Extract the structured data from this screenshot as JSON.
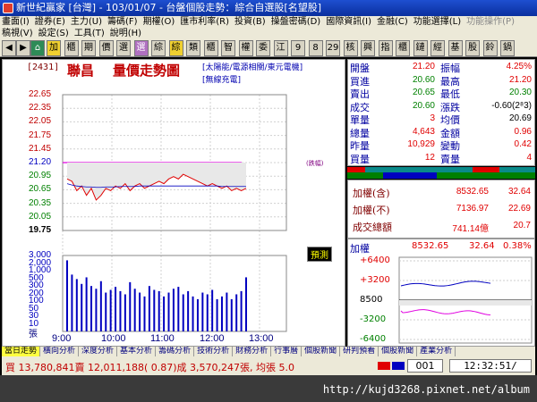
{
  "window": {
    "title": "新世紀贏家 [台灣] - 103/01/07 - 台盤個股走勢：綜合自選股[名望股]"
  },
  "menu": {
    "row1": [
      "畫面(I)",
      "證券(E)",
      "主力(U)",
      "籌碼(F)",
      "期權(O)",
      "匯市利率(R)",
      "投資(B)",
      "操盤密碼(D)",
      "國際資訊(I)",
      "金融(C)",
      "功能選擇(L)"
    ],
    "row1_dim": "功能操作(P)",
    "row2": [
      "稿視(V)",
      "設定(S)",
      "工具(T)",
      "說明(H)"
    ]
  },
  "toolbar": {
    "buttons": [
      "加",
      "櫃",
      "期",
      "價",
      "選",
      "選",
      "綜",
      "綜",
      "類",
      "櫃",
      "智",
      "權",
      "委",
      "江",
      "9",
      "8",
      "29",
      "核",
      "興",
      "指",
      "櫃",
      "鏈",
      "經",
      "基",
      "股",
      "鈴",
      "鍋"
    ]
  },
  "header": {
    "code": "[2431]",
    "name": "聯昌",
    "title": "量價走勢圖",
    "tag1": "[太陽能/電源相關/東元電機]",
    "tag2": "[無線充電]"
  },
  "chart_data": {
    "type": "line",
    "price_axis": {
      "ticks": [
        "22.65",
        "22.35",
        "22.05",
        "21.75",
        "21.45",
        "21.20",
        "20.95",
        "20.65",
        "20.35",
        "20.05",
        "19.75"
      ],
      "limit_label": "(跌幅)"
    },
    "volume_axis": {
      "ticks": [
        "3,000",
        "2,000",
        "1,000",
        "500",
        "300",
        "200",
        "100",
        "50",
        "30",
        "10",
        "張"
      ]
    },
    "x": {
      "ticks": [
        "9:00",
        "10:00",
        "11:00",
        "12:00",
        "13:00"
      ]
    },
    "reference_price": 21.2,
    "ylim": [
      19.75,
      22.65
    ],
    "price_series": [
      20.85,
      20.8,
      20.6,
      20.7,
      20.5,
      20.65,
      20.4,
      20.5,
      20.65,
      20.6,
      20.7,
      20.65,
      20.75,
      20.6,
      20.7,
      20.75,
      20.65,
      20.7,
      20.75,
      20.8,
      20.75,
      20.85,
      20.9,
      20.85,
      20.95,
      20.9,
      20.85,
      20.8,
      20.75,
      20.7,
      20.75,
      20.7,
      20.65,
      20.7,
      20.6,
      20.65,
      20.6,
      20.65
    ],
    "avg_series": [
      20.75,
      20.72,
      20.7,
      20.69,
      20.68,
      20.68,
      20.67,
      20.67,
      20.68,
      20.68,
      20.68,
      20.69,
      20.69,
      20.69,
      20.69,
      20.7,
      20.7,
      20.7,
      20.7,
      20.7,
      20.7,
      20.7,
      20.7,
      20.7,
      20.7,
      20.7,
      20.7,
      20.7,
      20.7,
      20.7,
      20.7,
      20.7,
      20.69,
      20.69,
      20.69,
      20.69,
      20.69,
      20.69
    ],
    "volume_series": [
      1800,
      400,
      250,
      150,
      300,
      120,
      90,
      200,
      60,
      80,
      110,
      70,
      50,
      180,
      90,
      60,
      40,
      120,
      80,
      70,
      40,
      60,
      90,
      110,
      50,
      70,
      40,
      30,
      60,
      50,
      80,
      30,
      40,
      60,
      30,
      50,
      70,
      300
    ],
    "predict_label": "預測"
  },
  "quote": {
    "rows": [
      {
        "l1": "開盤",
        "v1": "21.20",
        "c1": "red",
        "l2": "振幅",
        "v2": "4.25%",
        "c2": "red"
      },
      {
        "l1": "買進",
        "v1": "20.60",
        "c1": "grn",
        "l2": "最高",
        "v2": "21.20",
        "c2": "red"
      },
      {
        "l1": "賣出",
        "v1": "20.65",
        "c1": "grn",
        "l2": "最低",
        "v2": "20.30",
        "c2": "grn"
      },
      {
        "l1": "成交",
        "v1": "20.60",
        "c1": "grn",
        "l2": "漲跌",
        "v2": "-0.60(2⁸3)",
        "c2": "blk"
      },
      {
        "l1": "單量",
        "v1": "3",
        "c1": "red",
        "l2": "均價",
        "v2": "20.69",
        "c2": "blk"
      },
      {
        "l1": "總量",
        "v1": "4,643",
        "c1": "red",
        "l2": "金額",
        "v2": "0.96",
        "c2": "red"
      },
      {
        "l1": "昨量",
        "v1": "10,929",
        "c1": "red",
        "l2": "變動",
        "v2": "0.42",
        "c2": "red"
      },
      {
        "l1": "買量",
        "v1": "12",
        "c1": "red",
        "l2": "賣量",
        "v2": "4",
        "c2": "red"
      }
    ]
  },
  "index": {
    "rows": [
      {
        "label": "加權(含)",
        "value": "8532.65",
        "chg": "32.64"
      },
      {
        "label": "加權(不)",
        "value": "7136.97",
        "chg": "22.69"
      },
      {
        "label": "成交總額",
        "value": "741.14億",
        "chg": "20.7"
      }
    ]
  },
  "mini": {
    "label": "加權",
    "value": "8532.65",
    "chg": "32.64",
    "pct": "0.38%",
    "ticks": [
      "+6400",
      "+3200",
      "8500",
      "-3200",
      "-6400"
    ]
  },
  "tabs": [
    "當日走勢",
    "橫向分析",
    "深度分析",
    "基本分析",
    "籌碼分析",
    "技術分析",
    "財務分析",
    "行事曆",
    "個股新聞",
    "研判預看",
    "個股新聞",
    "產業分析"
  ],
  "status": {
    "text": "買 13,780,841賣 12,011,188( 0.87)成 3,570,247張, 均張 5.0",
    "code": "001",
    "time": "12:32:51/"
  },
  "url": "http://kujd3268.pixnet.net/album"
}
